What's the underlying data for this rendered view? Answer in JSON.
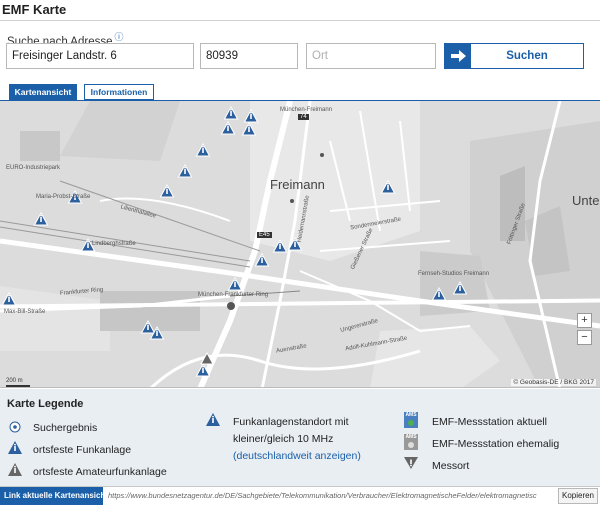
{
  "title": "EMF Karte",
  "search": {
    "label": "Suche nach Adresse",
    "info_symbol": "ⓘ",
    "street_value": "Freisinger Landstr. 6",
    "zip_value": "80939",
    "city_placeholder": "Ort",
    "button_label": "Suchen"
  },
  "tabs": [
    {
      "label": "Kartenansicht",
      "active": true
    },
    {
      "label": "Informationen",
      "active": false
    }
  ],
  "map": {
    "place_big": "Freimann",
    "place_right": "Unte",
    "labels": [
      "München-Freimann",
      "EURO-Industriepark",
      "Maria-Probst-Straße",
      "Lilienthalallee",
      "Frankfurter Ring",
      "Max-Bill-Straße",
      "Lindberghstraße",
      "Heidemannstraße",
      "Föttinger Straße",
      "München-Frankfurter Ring",
      "Ungererstraße",
      "Sondermeierstraße",
      "Gießener Straße",
      "Fernseh-Studios Freimann",
      "Adolf-Kuhlmann-Straße",
      "Auenstraße",
      "E45",
      "74"
    ],
    "zoom_in": "+",
    "zoom_out": "−",
    "scale": "200 m",
    "copyright": "© Geobasis-DE / BKG 2017"
  },
  "legend": {
    "title": "Karte Legende",
    "items": [
      {
        "label": "Suchergebnis",
        "icon": "search-result-icon"
      },
      {
        "label": "ortsfeste Funkanlage",
        "icon": "fixed-radio-station-icon"
      },
      {
        "label": "ortsfeste Amateurfunkanlage",
        "icon": "amateur-radio-station-icon"
      },
      {
        "label": "Funkanlagenstandort mit",
        "icon": "low-frequency-station-icon"
      },
      {
        "label": "kleiner/gleich 10 MHz"
      },
      {
        "label": "(deutschlandweit anzeigen)"
      },
      {
        "label": "EMF-Messstation aktuell",
        "icon": "ams-current-icon"
      },
      {
        "label": "EMF-Messstation ehemalig",
        "icon": "ams-former-icon"
      },
      {
        "label": "Messort",
        "icon": "measurement-location-icon"
      }
    ],
    "ams_text": "AMS"
  },
  "linkbar": {
    "label": "Link aktuelle Kartenansicht",
    "url": "https://www.bundesnetzagentur.de/DE/Sachgebiete/Telekommunikation/Verbraucher/ElektromagnetischeFelder/elektromagnetisc",
    "copy_label": "Kopieren"
  },
  "colors": {
    "accent": "#1a5fa8",
    "marker": "#2c5f9e",
    "amateur_marker": "#666666",
    "ams_current": "#4a7fc0"
  }
}
